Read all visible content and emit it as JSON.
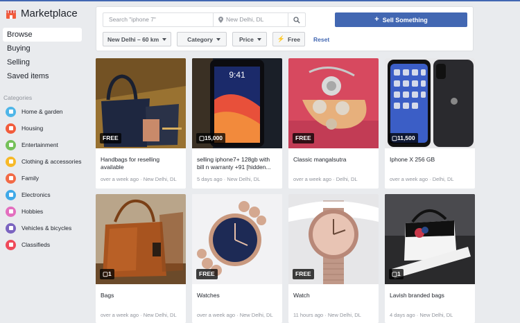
{
  "sidebar": {
    "title": "Marketplace",
    "nav": [
      "Browse",
      "Buying",
      "Selling",
      "Saved items"
    ],
    "categories_heading": "Categories",
    "categories": [
      {
        "label": "Home & garden",
        "color": "#4fb6e8"
      },
      {
        "label": "Housing",
        "color": "#f25c3c"
      },
      {
        "label": "Entertainment",
        "color": "#75c15a"
      },
      {
        "label": "Clothing & accessories",
        "color": "#f7b928"
      },
      {
        "label": "Family",
        "color": "#f26a46"
      },
      {
        "label": "Electronics",
        "color": "#3fa9e8"
      },
      {
        "label": "Hobbies",
        "color": "#e36fbf"
      },
      {
        "label": "Vehicles & bicycles",
        "color": "#7b64c0"
      },
      {
        "label": "Classifieds",
        "color": "#ef4a5a"
      }
    ]
  },
  "search": {
    "query_placeholder": "Search \"iphone 7\"",
    "location_placeholder": "New Delhi, DL"
  },
  "sell_button": "Sell Something",
  "filters": {
    "location": "New Delhi – 60 km",
    "category": "Category",
    "price": "Price",
    "free": "Free",
    "reset": "Reset"
  },
  "listings": [
    {
      "badge": "FREE",
      "title": "Handbags for reselling available",
      "meta": "over a week ago · New Delhi, DL"
    },
    {
      "badge": "15,000",
      "title": "selling iphone7+ 128gb with bill n warranty +91 [hidden...",
      "meta": "5 days ago · New Delhi, DL"
    },
    {
      "badge": "FREE",
      "title": "Classic mangalsutra",
      "meta": "over a week ago · Delhi, DL"
    },
    {
      "badge": "11,500",
      "title": "Iphone X 256 GB",
      "meta": "over a week ago · Delhi, DL"
    },
    {
      "badge": "1",
      "title": "Bags",
      "meta": "over a week ago · New Delhi, DL"
    },
    {
      "badge": "FREE",
      "title": "Watches",
      "meta": "over a week ago · New Delhi, DL"
    },
    {
      "badge": "FREE",
      "title": "Watch",
      "meta": "11 hours ago · New Delhi, DL"
    },
    {
      "badge": "1",
      "title": "Lavish branded bags",
      "meta": "4 days ago · New Delhi, DL"
    }
  ]
}
